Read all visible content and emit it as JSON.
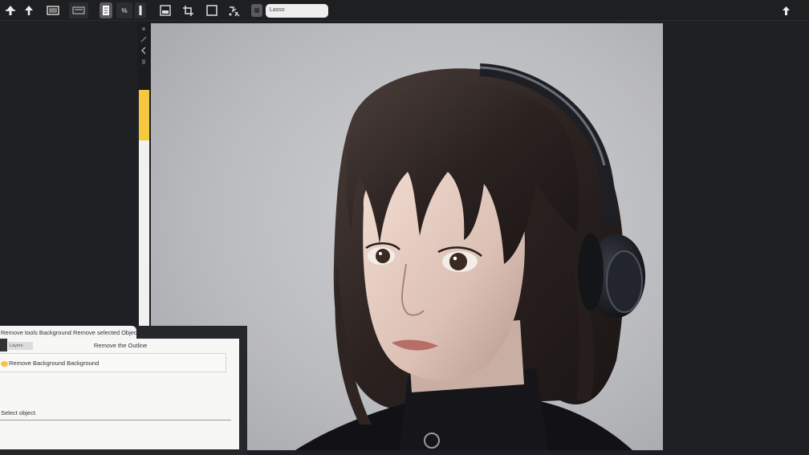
{
  "toolbar": {
    "items": [
      {
        "icon": "arrow-icon"
      },
      {
        "icon": "pin-icon"
      },
      {
        "icon": "layers-icon"
      },
      {
        "icon": "panel-icon"
      },
      {
        "icon": "page-icon"
      },
      {
        "label": "%"
      },
      {
        "icon": "divider-icon"
      },
      {
        "icon": "image-icon"
      },
      {
        "icon": "crop-icon"
      },
      {
        "icon": "frame-icon"
      },
      {
        "icon": "transform-icon"
      },
      {
        "icon": "stop-icon"
      }
    ],
    "search_value": "Lasso",
    "right_icon": "cursor-icon"
  },
  "tool_strip": {
    "icons": [
      "brush-icon",
      "eraser-icon",
      "lasso-icon",
      "smudge-icon"
    ]
  },
  "opacity_bar": {
    "fill_fraction": 0.21,
    "accent_color": "#f5c93e"
  },
  "canvas": {
    "subject": "portrait of a girl with bob haircut wearing headphones",
    "background_color": "#b9babe"
  },
  "dialog": {
    "tab_label": "Remove tools Background Remove selected Object",
    "chip_label": "Layers",
    "header": "Remove the Outline",
    "option_label": "Remove Background Background",
    "footer": "Select object."
  }
}
